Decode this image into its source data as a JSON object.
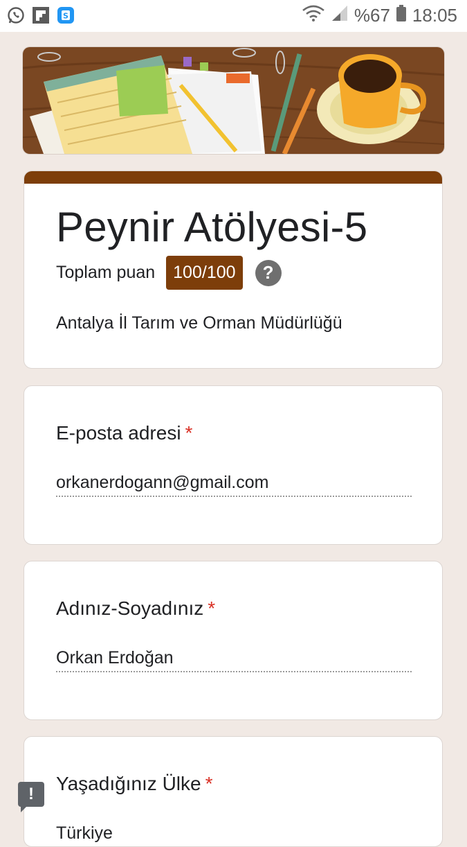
{
  "status_bar": {
    "battery_text": "%67",
    "time": "18:05",
    "apps": [
      "whatsapp-icon",
      "flipboard-icon",
      "s-app-icon"
    ]
  },
  "form": {
    "title": "Peynir Atölyesi-5",
    "score_label": "Toplam puan",
    "score_value": "100/100",
    "description": "Antalya İl Tarım ve Orman Müdürlüğü",
    "accent_color": "#7d3e0a"
  },
  "questions": [
    {
      "label": "E-posta adresi",
      "required": "*",
      "value": "orkanerdogann@gmail.com"
    },
    {
      "label": "Adınız-Soyadınız",
      "required": "*",
      "value": "Orkan Erdoğan"
    },
    {
      "label": "Yaşadığınız Ülke",
      "required": "*",
      "value": "Türkiye"
    }
  ]
}
